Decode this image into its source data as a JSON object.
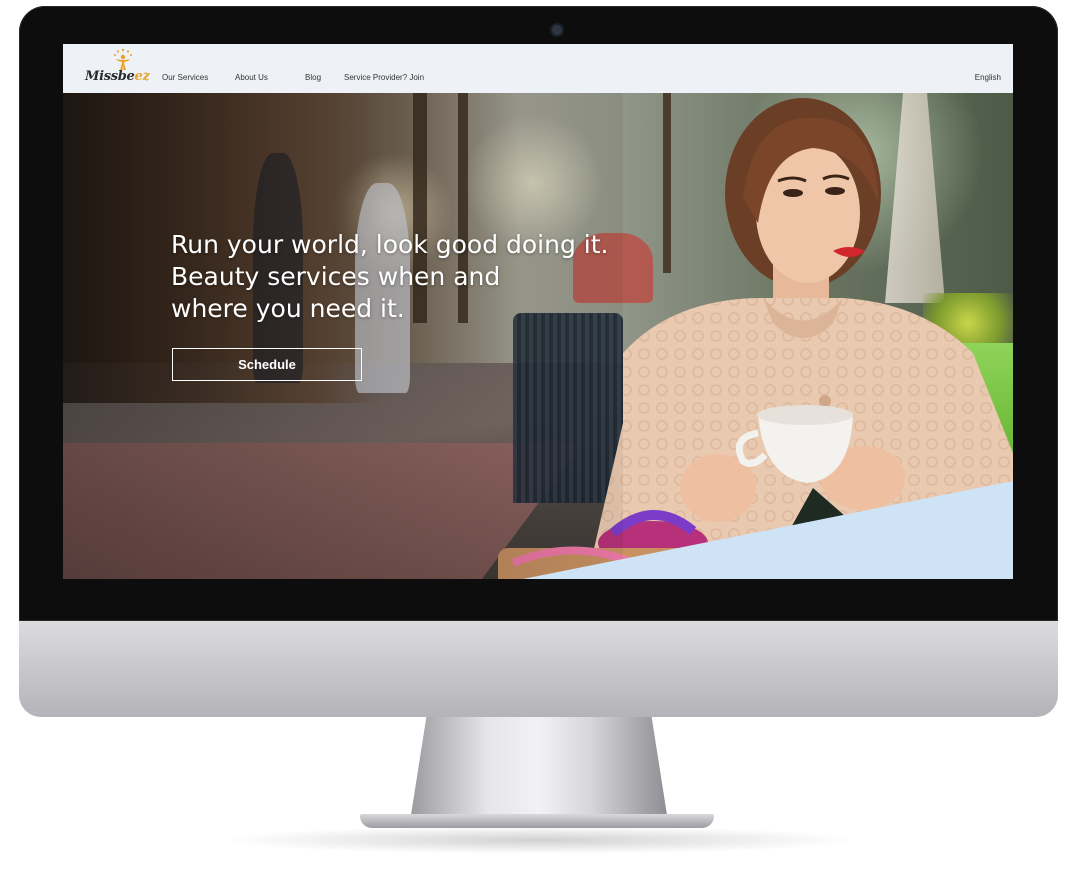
{
  "brand": {
    "logo_main": "Missbe",
    "logo_accent": "ez"
  },
  "nav": {
    "items": [
      {
        "label": "Our Services"
      },
      {
        "label": "About Us"
      },
      {
        "label": "Blog"
      },
      {
        "label": "Service Provider? Join"
      }
    ],
    "language": "English"
  },
  "hero": {
    "headline_lines": [
      "Run your world, look good doing it.",
      "Beauty services when and",
      "where you need it."
    ],
    "cta_label": "Schedule"
  },
  "colors": {
    "nav_bg": "#eef2f6",
    "accent": "#e9a12a",
    "diagonal_panel": "#cfe3f6",
    "cta_border": "#ffffff"
  },
  "icons": {
    "logo_mark": "stars-person-icon",
    "camera": "webcam-icon"
  }
}
